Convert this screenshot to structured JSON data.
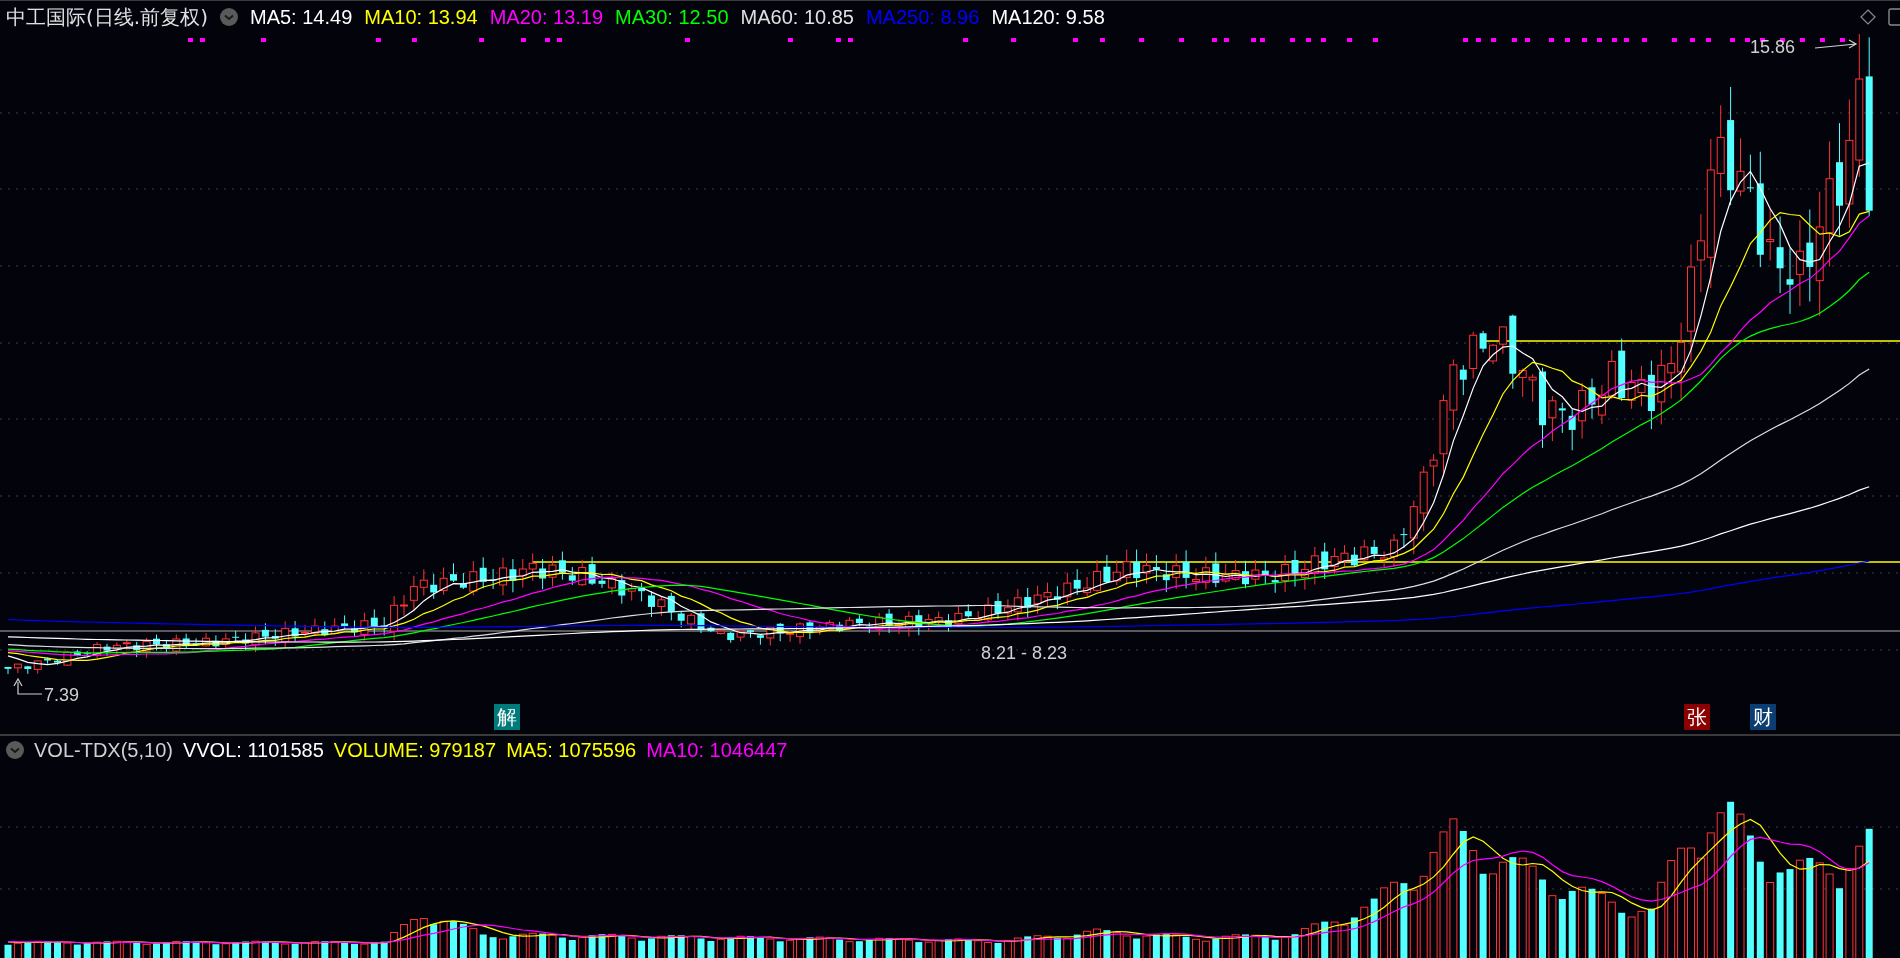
{
  "title": "中工国际(日线.前复权)",
  "indicators": [
    {
      "label": "MA5: 14.49",
      "color": "#ffffff"
    },
    {
      "label": "MA10: 13.94",
      "color": "#ffff00"
    },
    {
      "label": "MA20: 13.19",
      "color": "#ff00ff"
    },
    {
      "label": "MA30: 12.50",
      "color": "#00ff00"
    },
    {
      "label": "MA60: 10.85",
      "color": "#e0e0e0"
    },
    {
      "label": "MA250: 8.96",
      "color": "#0000ff"
    },
    {
      "label": "MA120: 9.58",
      "color": "#ffffff"
    }
  ],
  "price_chart": {
    "high_label": "15.86",
    "low_label": "7.39",
    "range_label": "8.21 - 8.23",
    "markers": [
      {
        "text": "解",
        "color": "#007b7b"
      },
      {
        "text": "张",
        "color": "#8b0000"
      },
      {
        "text": "财",
        "color": "#0b3d73"
      }
    ]
  },
  "volume_panel": {
    "name": "VOL-TDX(5,10)",
    "indicators": [
      {
        "label": "VVOL: 1101585",
        "color": "#ffffff"
      },
      {
        "label": "VOLUME: 979187",
        "color": "#ffff00"
      },
      {
        "label": "MA5: 1075596",
        "color": "#ffff00"
      },
      {
        "label": "MA10: 1046447",
        "color": "#ff00ff"
      }
    ]
  }
}
